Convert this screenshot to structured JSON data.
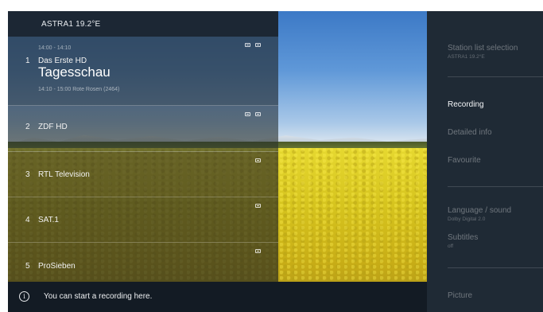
{
  "top_bar": {
    "satellite": "ASTRA1 19.2°E"
  },
  "channels": [
    {
      "number": "1",
      "name": "Das Erste HD",
      "time": "14:00 - 14:10",
      "program": "Tagesschau",
      "next": "14:10 - 15:00  Rote Rosen (2464)"
    },
    {
      "number": "2",
      "name": "ZDF HD"
    },
    {
      "number": "3",
      "name": "RTL Television"
    },
    {
      "number": "4",
      "name": "SAT.1"
    },
    {
      "number": "5",
      "name": "ProSieben"
    }
  ],
  "info_bar": {
    "icon": "i",
    "text": "You can start a recording here."
  },
  "side_menu": {
    "station_list": {
      "label": "Station list selection",
      "sub": "ASTRA1 19.2°E"
    },
    "recording": "Recording",
    "detailed_info": "Detailed info",
    "favourite": "Favourite",
    "language": {
      "label": "Language / sound",
      "sub": "Dolby Digital 2.0"
    },
    "subtitles": {
      "label": "Subtitles",
      "sub": "off"
    },
    "picture": "Picture"
  },
  "colors": {
    "panel": "#1f2a35",
    "bar": "#131b24",
    "accent_text": "#f4f6f8"
  }
}
